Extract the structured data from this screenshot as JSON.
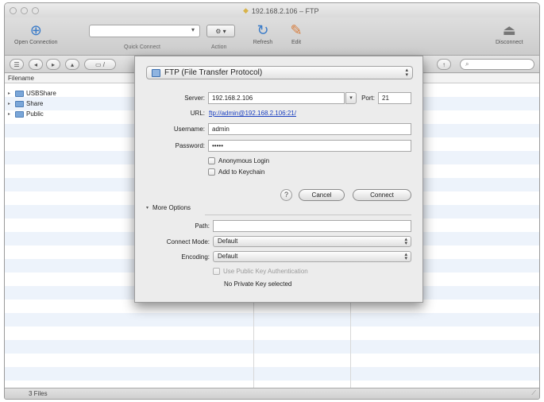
{
  "window": {
    "title": "192.168.2.106 – FTP"
  },
  "toolbar": {
    "open_connection_label": "Open Connection",
    "quick_connect_label": "Quick Connect",
    "action_label": "Action",
    "refresh_label": "Refresh",
    "edit_label": "Edit",
    "disconnect_label": "Disconnect"
  },
  "browser": {
    "column_header": "Filename",
    "items": [
      {
        "name": "USBShare"
      },
      {
        "name": "Share"
      },
      {
        "name": "Public"
      }
    ],
    "status": "3 Files"
  },
  "sheet": {
    "protocol": "FTP (File Transfer Protocol)",
    "server_label": "Server:",
    "server_value": "192.168.2.106",
    "port_label": "Port:",
    "port_value": "21",
    "url_label": "URL:",
    "url_value": "ftp://admin@192.168.2.106:21/",
    "username_label": "Username:",
    "username_value": "admin",
    "password_label": "Password:",
    "password_value": "•••••",
    "anonymous_label": "Anonymous Login",
    "keychain_label": "Add to Keychain",
    "help_label": "?",
    "cancel_label": "Cancel",
    "connect_label": "Connect",
    "more_options_label": "More Options",
    "path_label": "Path:",
    "path_value": "",
    "connect_mode_label": "Connect Mode:",
    "connect_mode_value": "Default",
    "encoding_label": "Encoding:",
    "encoding_value": "Default",
    "pubkey_label": "Use Public Key Authentication",
    "no_key_label": "No Private Key selected"
  },
  "colors": {
    "link": "#1a3fc0",
    "folder": "#7aa6d8",
    "row_stripe": "#edf3fb"
  }
}
